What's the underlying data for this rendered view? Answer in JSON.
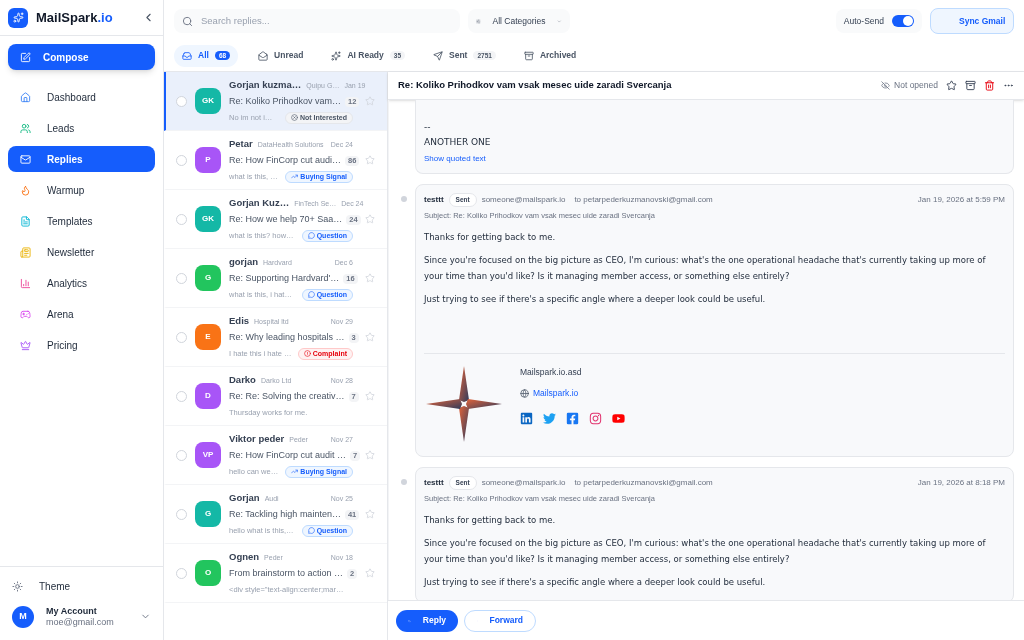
{
  "brand": {
    "name": "MailSpark",
    "suffix": ".io"
  },
  "compose": "Compose",
  "nav": [
    {
      "label": "Dashboard",
      "selected": false
    },
    {
      "label": "Leads",
      "selected": false
    },
    {
      "label": "Replies",
      "selected": true
    },
    {
      "label": "Warmup",
      "selected": false
    },
    {
      "label": "Templates",
      "selected": false
    },
    {
      "label": "Newsletter",
      "selected": false
    },
    {
      "label": "Analytics",
      "selected": false
    },
    {
      "label": "Arena",
      "selected": false
    },
    {
      "label": "Pricing",
      "selected": false
    }
  ],
  "theme": "Theme",
  "account": {
    "initial": "M",
    "name": "My Account",
    "email": "moe@gmail.com"
  },
  "search": {
    "placeholder": "Search replies..."
  },
  "category": "All Categories",
  "auto_send": {
    "label": "Auto-Send",
    "on": true
  },
  "sync": "Sync Gmail",
  "tabs": [
    {
      "label": "All",
      "count": "68",
      "selected": true
    },
    {
      "label": "Unread",
      "selected": false
    },
    {
      "label": "AI Ready",
      "count": "35",
      "selected": false
    },
    {
      "label": "Sent",
      "count": "2751",
      "selected": false
    },
    {
      "label": "Archived",
      "selected": false
    }
  ],
  "threads": [
    {
      "initials": "GK",
      "color": "#14b8a6",
      "name": "Gorjan kuzma…",
      "company": "Quipu G…",
      "date": "Jan 19",
      "subject": "Re: Koliko Prihodkov vam…",
      "count": "12",
      "preview": "No im not i…",
      "tag": {
        "kind": "not_interested",
        "label": "Not Interested"
      },
      "selected": true
    },
    {
      "initials": "P",
      "color": "#a855f7",
      "name": "Petar",
      "company": "DataHealth Solutions",
      "date": "Dec 24",
      "subject": "Re: How FinCorp cut audi…",
      "count": "86",
      "preview": "what is this, …",
      "tag": {
        "kind": "buying",
        "label": "Buying Signal"
      },
      "selected": false
    },
    {
      "initials": "GK",
      "color": "#14b8a6",
      "name": "Gorjan Kuz…",
      "company": "FinTech Se…",
      "date": "Dec 24",
      "subject": "Re: How we help 70+ Saa…",
      "count": "24",
      "preview": "what is this? how…",
      "tag": {
        "kind": "question",
        "label": "Question"
      },
      "selected": false
    },
    {
      "initials": "G",
      "color": "#22c55e",
      "name": "gorjan",
      "company": "Hardvard",
      "date": "Dec 6",
      "subject": "Re: Supporting Hardvard'…",
      "count": "16",
      "preview": "what is this, i hat…",
      "tag": {
        "kind": "question",
        "label": "Question"
      },
      "selected": false
    },
    {
      "initials": "E",
      "color": "#f97316",
      "name": "Edis",
      "company": "Hospital ltd",
      "date": "Nov 29",
      "subject": "Re: Why leading hospitals …",
      "count": "3",
      "preview": "I hate this i hate …",
      "tag": {
        "kind": "complaint",
        "label": "Complaint"
      },
      "selected": false
    },
    {
      "initials": "D",
      "color": "#a855f7",
      "name": "Darko",
      "company": "Darko Ltd",
      "date": "Nov 28",
      "subject": "Re: Re: Solving the creativ…",
      "count": "7",
      "preview": "Thursday works for me.",
      "selected": false
    },
    {
      "initials": "VP",
      "color": "#a855f7",
      "name": "Viktor peder",
      "company": "Peder",
      "date": "Nov 27",
      "subject": "Re: How FinCorp cut audit …",
      "count": "7",
      "preview": "hello can we…",
      "tag": {
        "kind": "buying",
        "label": "Buying Signal"
      },
      "selected": false
    },
    {
      "initials": "G",
      "color": "#14b8a6",
      "name": "Gorjan",
      "company": "Audi",
      "date": "Nov 25",
      "subject": "Re: Tackling high mainten…",
      "count": "41",
      "preview": "hello what is this,…",
      "tag": {
        "kind": "question",
        "label": "Question"
      },
      "selected": false
    },
    {
      "initials": "O",
      "color": "#22c55e",
      "name": "Ognen",
      "company": "Peder",
      "date": "Nov 18",
      "subject": "From brainstorm to action …",
      "count": "2",
      "preview": "<div style=\"text-align:center;mar…",
      "selected": false
    }
  ],
  "detail": {
    "subject": "Re: Koliko Prihodkov vam vsak mesec uide zaradi Svercanja",
    "status": "Not opened",
    "messages": [
      {
        "kind": "quoted",
        "lines": [
          "--",
          "ANOTHER ONE"
        ],
        "link": "Show quoted text"
      },
      {
        "kind": "full",
        "sender": "testtt",
        "badge": "Sent",
        "from": "someone@mailspark.io",
        "to": "to petarpederkuzmanovski@gmail.com",
        "date": "Jan 19, 2026 at 5:59 PM",
        "subject": "Subject: Re: Koliko Prihodkov vam vsak mesec uide zaradi Svercanja",
        "paragraphs": [
          "Thanks for getting back to me.",
          "Since you're focused on the big picture as CEO, I'm curious: what's the one operational headache that's currently taking up more of your time than you'd like? Is it managing member access, or something else entirely?",
          "Just trying to see if there's a specific angle where a deeper look could be useful."
        ],
        "signature": {
          "name": "Mailspark.io.asd",
          "link": "Mailspark.io"
        }
      },
      {
        "kind": "full",
        "sender": "testtt",
        "badge": "Sent",
        "from": "someone@mailspark.io",
        "to": "to petarpederkuzmanovski@gmail.com",
        "date": "Jan 19, 2026 at 8:18 PM",
        "subject": "Subject: Re: Koliko Prihodkov vam vsak mesec uide zaradi Svercanja",
        "paragraphs": [
          "Thanks for getting back to me.",
          "Since you're focused on the big picture as CEO, I'm curious: what's the one operational headache that's currently taking up more of your time than you'd like? Is it managing member access, or something else entirely?",
          "Just trying to see if there's a specific angle where a deeper look could be useful."
        ]
      }
    ]
  },
  "actions": {
    "reply": "Reply",
    "forward": "Forward"
  }
}
